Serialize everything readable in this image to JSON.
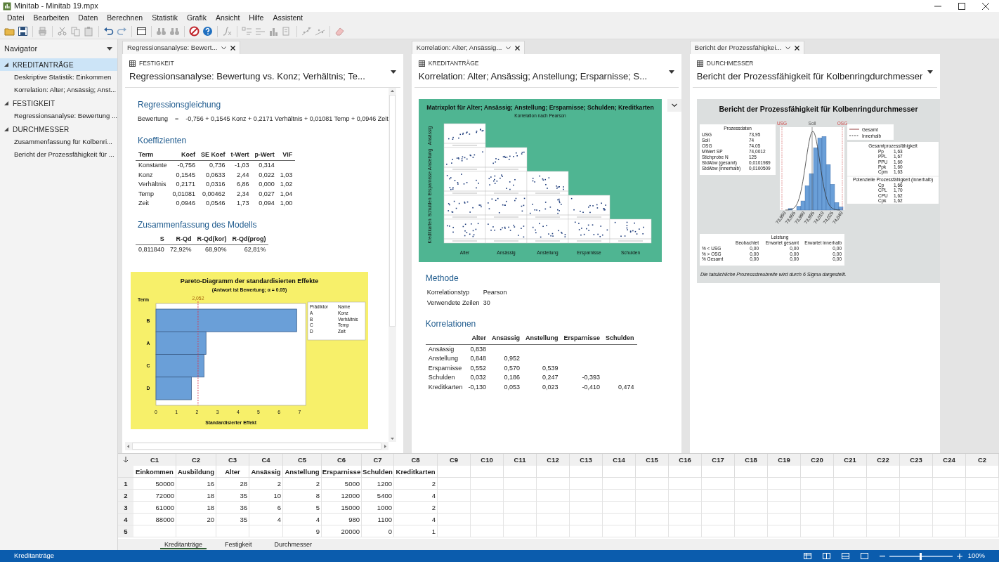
{
  "window": {
    "title": "Minitab - Minitab 19.mpx"
  },
  "menu": [
    "Datei",
    "Bearbeiten",
    "Daten",
    "Berechnen",
    "Statistik",
    "Grafik",
    "Ansicht",
    "Hilfe",
    "Assistent"
  ],
  "navigator": {
    "title": "Navigator",
    "groups": [
      {
        "label": "KREDITANTRÄGE",
        "expanded": true,
        "selected": true,
        "children": [
          {
            "label": "Deskriptive Statistik: Einkommen",
            "selected": false
          },
          {
            "label": "Korrelation: Alter; Ansässig; Anst...",
            "selected": false
          }
        ]
      },
      {
        "label": "FESTIGKEIT",
        "expanded": true,
        "selected": false,
        "children": [
          {
            "label": "Regressionsanalyse: Bewertung ...",
            "selected": false
          }
        ]
      },
      {
        "label": "DURCHMESSER",
        "expanded": true,
        "selected": false,
        "children": [
          {
            "label": "Zusammenfassung für Kolbenri...",
            "selected": false
          },
          {
            "label": "Bericht der Prozessfähigkeit für ...",
            "selected": false
          }
        ]
      }
    ]
  },
  "panes": [
    {
      "kind": "regression",
      "tab": "Regressionsanalyse: Bewert...",
      "worksheet": "FESTIGKEIT",
      "title": "Regressionsanalyse: Bewertung vs. Konz; Verhältnis; Te...",
      "equation": {
        "heading": "Regressionsgleichung",
        "response": "Bewertung",
        "sign": "=",
        "terms": "-0,756 + 0,1545 Konz + 0,2171 Verhältnis + 0,01081 Temp + 0,0946 Zeit"
      },
      "coefficients": {
        "heading": "Koeffizienten",
        "columns": [
          "Term",
          "Koef",
          "SE Koef",
          "t-Wert",
          "p-Wert",
          "VIF"
        ],
        "rows": [
          [
            "Konstante",
            "-0,756",
            "0,736",
            "-1,03",
            "0,314",
            null
          ],
          [
            "Konz",
            "0,1545",
            "0,0633",
            "2,44",
            "0,022",
            "1,03"
          ],
          [
            "Verhältnis",
            "0,2171",
            "0,0316",
            "6,86",
            "0,000",
            "1,02"
          ],
          [
            "Temp",
            "0,01081",
            "0,00462",
            "2,34",
            "0,027",
            "1,04"
          ],
          [
            "Zeit",
            "0,0946",
            "0,0546",
            "1,73",
            "0,094",
            "1,00"
          ]
        ]
      },
      "summary": {
        "heading": "Zusammenfassung des Modells",
        "columns": [
          "S",
          "R-Qd",
          "R-Qd(kor)",
          "R-Qd(prog)"
        ],
        "rows": [
          [
            "0,811840",
            "72,92%",
            "68,90%",
            "62,81%"
          ]
        ]
      },
      "pareto": {
        "subtitle": "(Antwort ist Bewertung; α = 0.05)",
        "legend": {
          "columns": [
            "Prädiktor",
            "Name"
          ],
          "rows": [
            [
              "A",
              "Konz"
            ],
            [
              "B",
              "Verhältnis"
            ],
            [
              "C",
              "Temp"
            ],
            [
              "D",
              "Zeit"
            ]
          ]
        },
        "chart_data": {
          "type": "bar",
          "orientation": "horizontal",
          "title": "Pareto-Diagramm der standardisierten Effekte",
          "xlabel": "Standardisierter Effekt",
          "ylabel": "Term",
          "categories": [
            "B",
            "A",
            "C",
            "D"
          ],
          "values": [
            6.86,
            2.44,
            2.34,
            1.73
          ],
          "xlim": [
            0,
            7.3
          ],
          "xticks": [
            0,
            1,
            2,
            3,
            4,
            5,
            6,
            7
          ],
          "ref_lines": [
            {
              "axis": "x",
              "value": 2.052,
              "label": "2,052"
            }
          ]
        }
      }
    },
    {
      "kind": "correlation",
      "tab": "Korrelation: Alter; Ansässig...",
      "worksheet": "KREDITANTRÄGE",
      "title": "Korrelation: Alter; Ansässig; Anstellung; Ersparnisse; S...",
      "matrix_plot": {
        "title": "Matrixplot für Alter; Ansässig; Anstellung; Ersparnisse; Schulden; Kreditkarten",
        "subtitle": "Korrelation nach Pearson",
        "x_labels": [
          "Alter",
          "Ansässig",
          "Anstellung",
          "Ersparnisse",
          "Schulden"
        ],
        "y_labels": [
          "Ansässig",
          "Anstellung",
          "Ersparnisse",
          "Schulden",
          "Kreditkarten"
        ]
      },
      "method": {
        "heading": "Methode",
        "rows": [
          [
            "Korrelationstyp",
            "Pearson"
          ],
          [
            "Verwendete Zeilen",
            "30"
          ]
        ]
      },
      "correlations": {
        "heading": "Korrelationen",
        "columns": [
          null,
          "Alter",
          "Ansässig",
          "Anstellung",
          "Ersparnisse",
          "Schulden"
        ],
        "rows": [
          [
            "Ansässig",
            "0,838",
            null,
            null,
            null,
            null
          ],
          [
            "Anstellung",
            "0,848",
            "0,952",
            null,
            null,
            null
          ],
          [
            "Ersparnisse",
            "0,552",
            "0,570",
            "0,539",
            null,
            null
          ],
          [
            "Schulden",
            "0,032",
            "0,186",
            "0,247",
            "-0,393",
            null
          ],
          [
            "Kreditkarten",
            "-0,130",
            "0,053",
            "0,023",
            "-0,410",
            "0,474"
          ]
        ]
      }
    },
    {
      "kind": "capability",
      "tab": "Bericht der Prozessfähigkei...",
      "worksheet": "DURCHMESSER",
      "title": "Bericht der Prozessfähigkeit für Kolbenringdurchmesser",
      "report": {
        "title": "Bericht der Prozessfähigkeit für Kolbenringdurchmesser",
        "process_data": {
          "heading": "Prozessdaten",
          "rows": [
            [
              "USG",
              "73,95"
            ],
            [
              "Soll",
              "74"
            ],
            [
              "OSG",
              "74,05"
            ],
            [
              "MWert SP",
              "74,0012"
            ],
            [
              "Stichprobe N",
              "125"
            ],
            [
              "StdAbw (gesamt)",
              "0,0101989"
            ],
            [
              "StdAbw (innerhalb)",
              "0,0100509"
            ]
          ]
        },
        "spec_labels": [
          "USG",
          "Soll",
          "OSG"
        ],
        "x_ticks": [
          "73,950",
          "73,965",
          "73,980",
          "73,995",
          "74,010",
          "74,025",
          "74,040"
        ],
        "legend": [
          "Gesamt",
          "Innerhalb"
        ],
        "overall": {
          "heading": "Gesamtprozessfähigkeit",
          "rows": [
            [
              "Pp",
              "1,63"
            ],
            [
              "PPL",
              "1,67"
            ],
            [
              "PPU",
              "1,60"
            ],
            [
              "Ppk",
              "1,60"
            ],
            [
              "Cpm",
              "1,63"
            ]
          ]
        },
        "potential": {
          "heading": "Potenzielle Prozessfähigkeit (innerhalb)",
          "rows": [
            [
              "Cp",
              "1,66"
            ],
            [
              "CPL",
              "1,70"
            ],
            [
              "CPU",
              "1,62"
            ],
            [
              "Cpk",
              "1,62"
            ]
          ]
        },
        "performance": {
          "heading": "Leistung",
          "columns": [
            null,
            "Beobachtet",
            "Erwartet gesamt",
            "Erwartet innerhalb"
          ],
          "rows": [
            [
              "% < USG",
              "0,00",
              "0,00",
              "0,00"
            ],
            [
              "% > OSG",
              "0,00",
              "0,00",
              "0,00"
            ],
            [
              "% Gesamt",
              "0,00",
              "0,00",
              "0,00"
            ]
          ]
        },
        "footnote": "Die tatsächliche Prozessstreubreite wird durch 6 Sigma dargestellt."
      }
    }
  ],
  "worksheet": {
    "columns": [
      "C1",
      "C2",
      "C3",
      "C4",
      "C5",
      "C6",
      "C7",
      "C8",
      "C9",
      "C10",
      "C11",
      "C12",
      "C13",
      "C14",
      "C15",
      "C16",
      "C17",
      "C18",
      "C19",
      "C20",
      "C21",
      "C22",
      "C23",
      "C24",
      "C2"
    ],
    "names": [
      "Einkommen",
      "Ausbildung",
      "Alter",
      "Ansässig",
      "Anstellung",
      "Ersparnisse",
      "Schulden",
      "Kreditkarten"
    ],
    "rows": [
      {
        "number": "1",
        "cells": [
          "50000",
          "16",
          "28",
          "2",
          "2",
          "5000",
          "1200",
          "2"
        ]
      },
      {
        "number": "2",
        "cells": [
          "72000",
          "18",
          "35",
          "10",
          "8",
          "12000",
          "5400",
          "4"
        ]
      },
      {
        "number": "3",
        "cells": [
          "61000",
          "18",
          "36",
          "6",
          "5",
          "15000",
          "1000",
          "2"
        ]
      },
      {
        "number": "4",
        "cells": [
          "88000",
          "20",
          "35",
          "4",
          "4",
          "980",
          "1100",
          "4"
        ]
      },
      {
        "number": "5",
        "cells": [
          null,
          null,
          null,
          null,
          "9",
          "20000",
          "0",
          "1"
        ]
      }
    ],
    "sheets": [
      {
        "label": "Kreditanträge",
        "selected": true
      },
      {
        "label": "Festigkeit",
        "selected": false
      },
      {
        "label": "Durchmesser",
        "selected": false
      }
    ]
  },
  "status_bar": {
    "text": "Kreditanträge",
    "zoom_slider": {
      "level": 0.5
    },
    "zoom": "100%"
  }
}
